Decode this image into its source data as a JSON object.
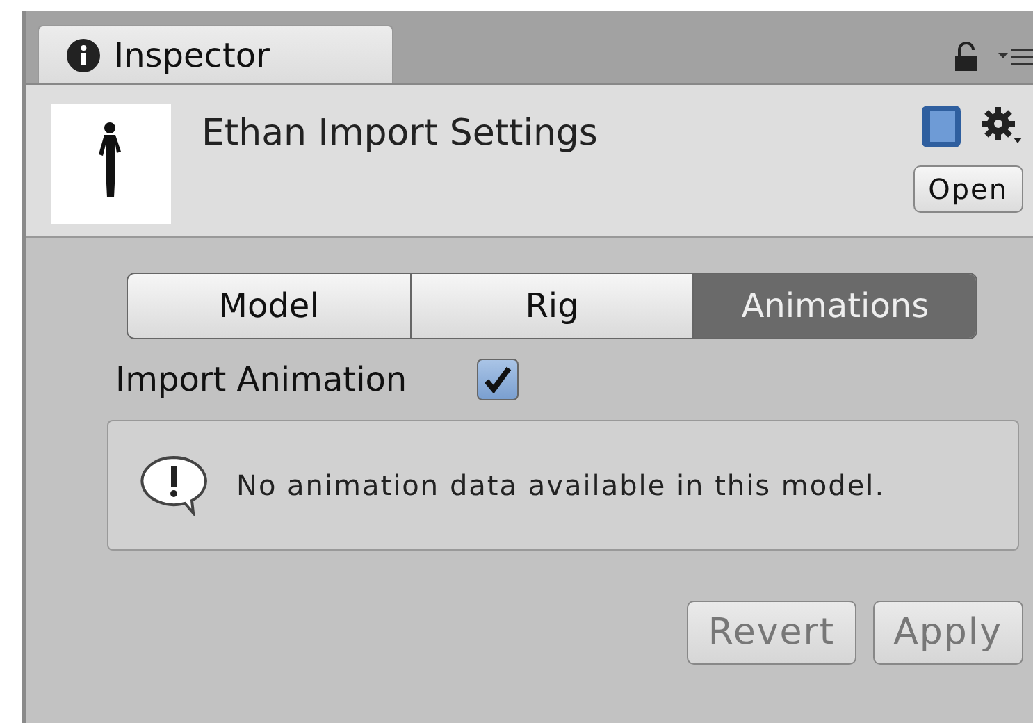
{
  "tab": {
    "label": "Inspector",
    "selected": true
  },
  "header": {
    "title": "Ethan Import Settings",
    "open_button": "Open"
  },
  "segments": [
    {
      "label": "Model",
      "selected": false
    },
    {
      "label": "Rig",
      "selected": false
    },
    {
      "label": "Animations",
      "selected": true
    }
  ],
  "import_animation": {
    "label": "Import Animation",
    "checked": true
  },
  "help_box": {
    "message": "No animation data available in this model."
  },
  "buttons": [
    {
      "label": "Revert",
      "disabled": true
    },
    {
      "label": "Apply",
      "disabled": true
    }
  ]
}
